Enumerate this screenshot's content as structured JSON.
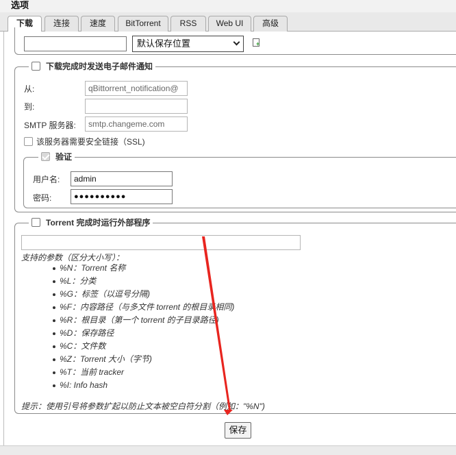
{
  "window": {
    "title": "选项"
  },
  "tabs": [
    {
      "label": "下载",
      "active": true
    },
    {
      "label": "连接"
    },
    {
      "label": "速度"
    },
    {
      "label": "BitTorrent"
    },
    {
      "label": "RSS"
    },
    {
      "label": "Web UI"
    },
    {
      "label": "高级"
    }
  ],
  "save_path_row": {
    "path_value": "",
    "select_value": "默认保存位置",
    "add_icon": "add-file-icon"
  },
  "email": {
    "legend": "下载完成时发送电子邮件通知",
    "enabled": false,
    "from_label": "从:",
    "from_placeholder": "qBittorrent_notification@",
    "to_label": "到:",
    "to_value": "",
    "smtp_label": "SMTP 服务器:",
    "smtp_placeholder": "smtp.changeme.com",
    "ssl_label": "该服务器需要安全链接（SSL)",
    "ssl_enabled": false,
    "auth": {
      "legend": "验证",
      "enabled": true,
      "user_label": "用户名:",
      "user_value": "admin",
      "pass_label": "密码:",
      "pass_value": "●●●●●●●●●●"
    }
  },
  "external_program": {
    "legend": "Torrent 完成时运行外部程序",
    "enabled": false,
    "command_value": "",
    "params_title": "支持的参数（区分大小写）：",
    "params": [
      "%N：Torrent 名称",
      "%L：分类",
      "%G：标签（以逗号分隔)",
      "%F：内容路径（与多文件 torrent 的根目录相同)",
      "%R：根目录（第一个 torrent 的子目录路径)",
      "%D：保存路径",
      "%C：文件数",
      "%Z：Torrent 大小（字节)",
      "%T：当前 tracker",
      "%I: Info hash"
    ],
    "hint": "提示：使用引号将参数扩起以防止文本被空白符分割（例如：\"%N\")"
  },
  "actions": {
    "save_label": "保存"
  },
  "annotation": {
    "arrow_color": "#e8251f"
  }
}
